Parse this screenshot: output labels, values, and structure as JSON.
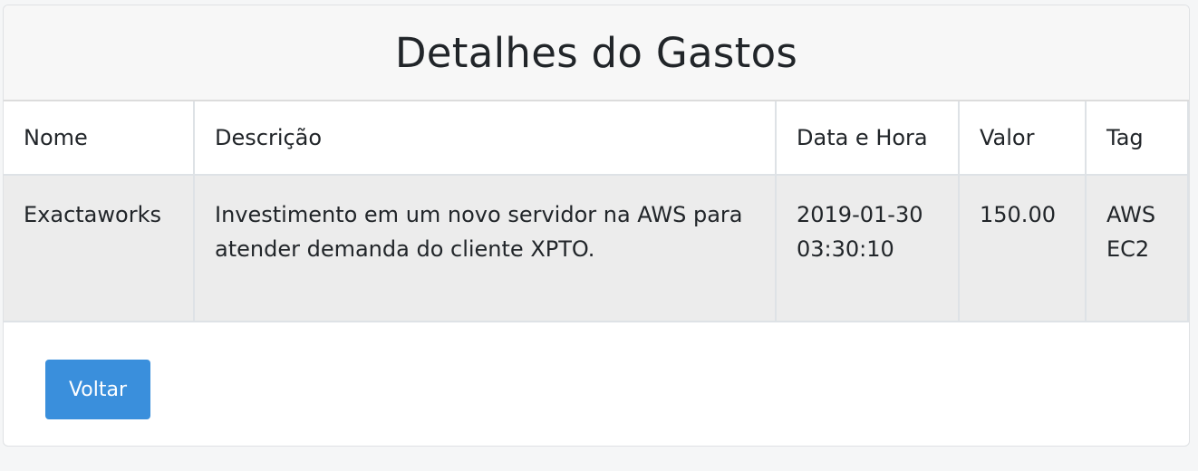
{
  "header": {
    "title": "Detalhes do Gastos"
  },
  "table": {
    "columns": [
      "Nome",
      "Descrição",
      "Data e Hora",
      "Valor",
      "Tag"
    ],
    "rows": [
      {
        "nome": "Exactaworks",
        "descricao": "Investimento em um novo servidor na AWS para atender demanda do cliente XPTO.",
        "data_hora": "2019-01-30 03:30:10",
        "valor": "150.00",
        "tag": "AWS EC2"
      }
    ]
  },
  "footer": {
    "back_label": "Voltar"
  },
  "colors": {
    "button": "#3a8fdc",
    "row_background": "#ececec",
    "header_background": "#f7f7f7"
  }
}
